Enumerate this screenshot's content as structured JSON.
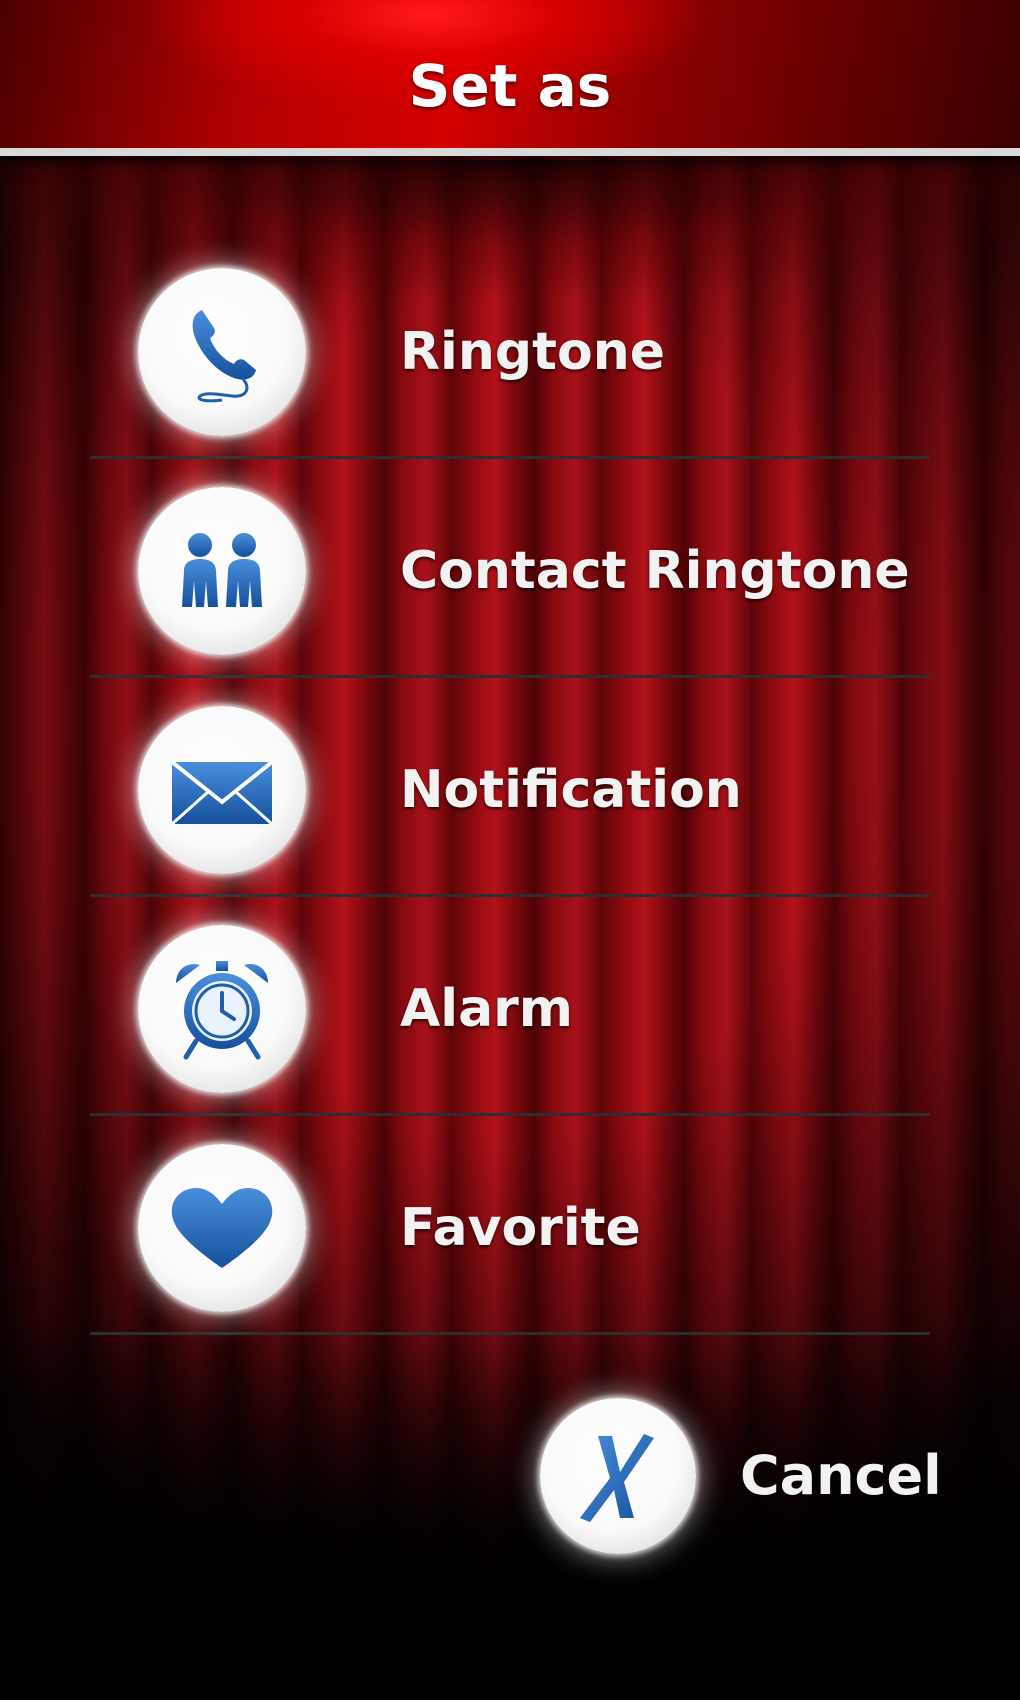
{
  "header": {
    "title": "Set as"
  },
  "menu": {
    "items": [
      {
        "label": "Ringtone",
        "icon": "phone-icon"
      },
      {
        "label": "Contact Ringtone",
        "icon": "contacts-icon"
      },
      {
        "label": "Notification",
        "icon": "envelope-icon"
      },
      {
        "label": "Alarm",
        "icon": "alarm-clock-icon"
      },
      {
        "label": "Favorite",
        "icon": "heart-icon"
      }
    ]
  },
  "cancel": {
    "label": "Cancel",
    "icon": "close-x-icon"
  },
  "colors": {
    "icon_blue": "#1f5fb0",
    "header_red": "#d40000",
    "divider": "#2e2e2e",
    "text": "#f2f2f2"
  }
}
